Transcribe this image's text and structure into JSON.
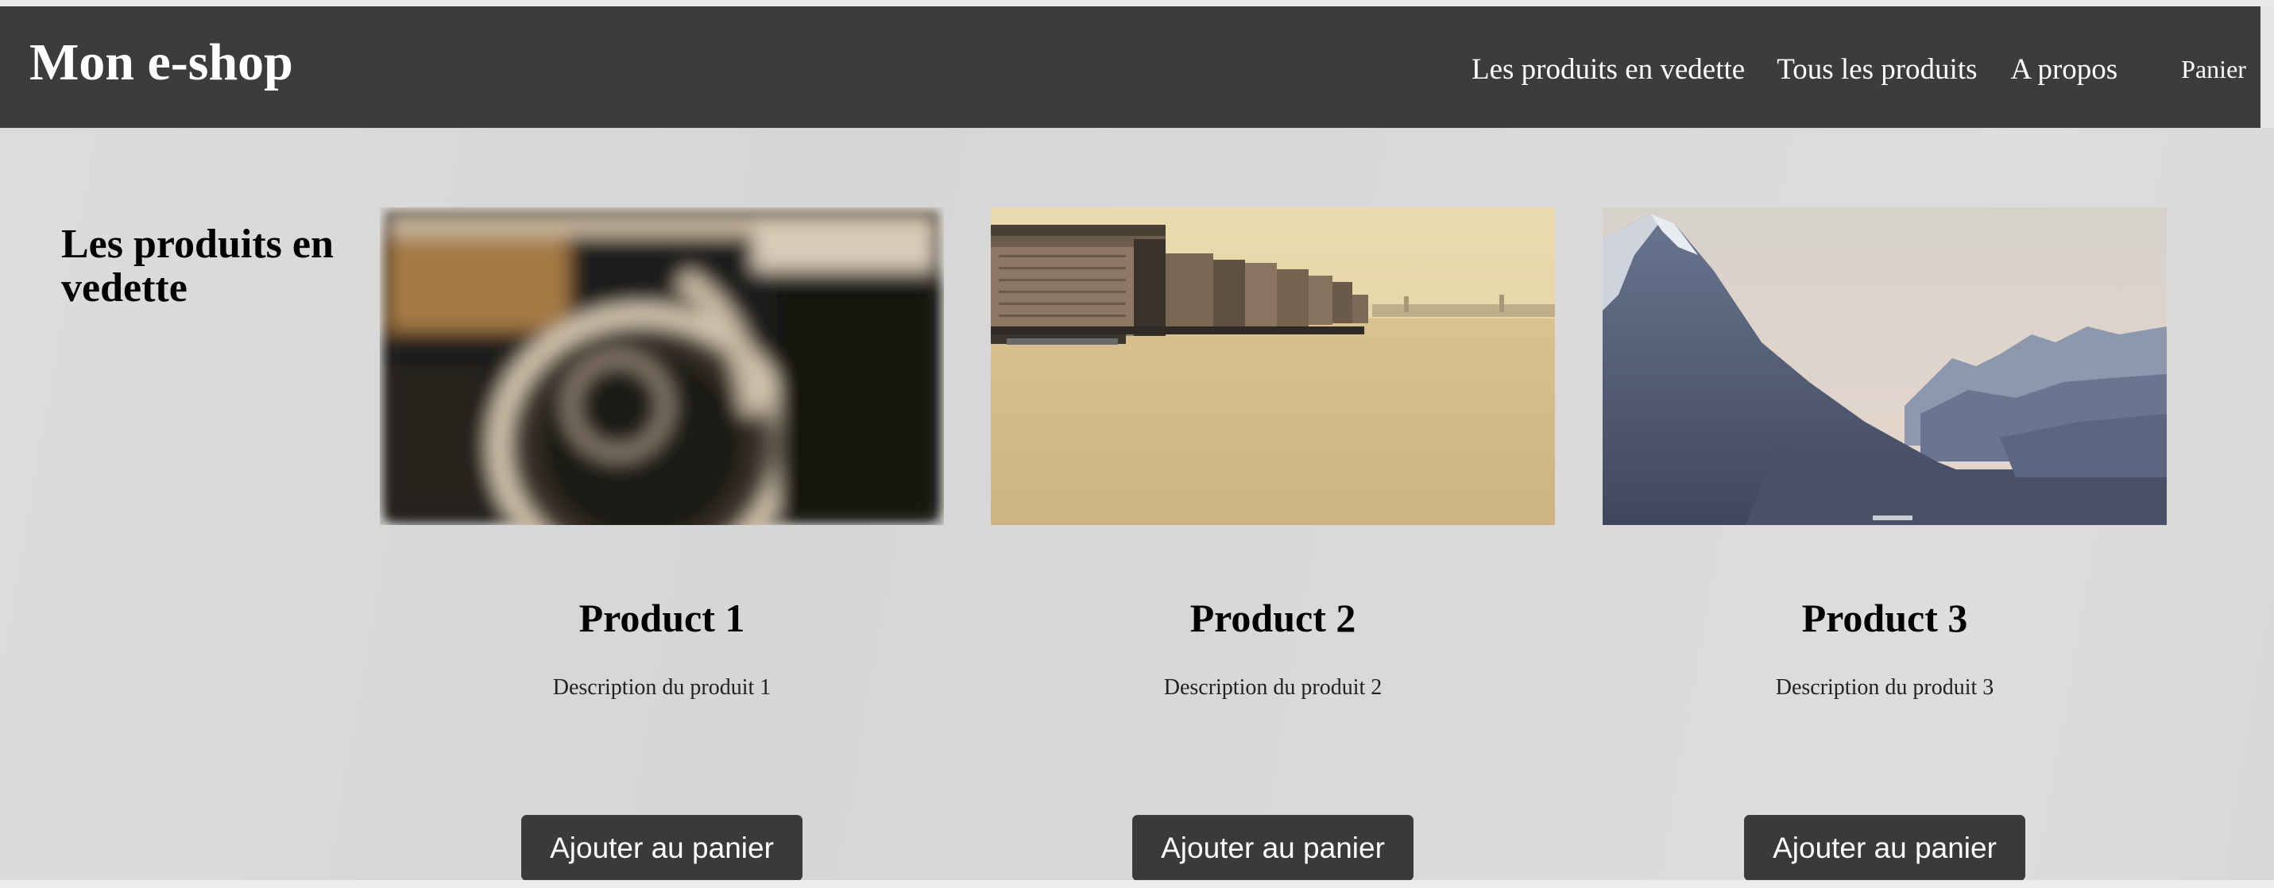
{
  "header": {
    "logo": "Mon e-shop",
    "nav": {
      "featured": "Les produits en vedette",
      "all_products": "Tous les produits",
      "about": "A propos",
      "cart": "Panier"
    }
  },
  "featured_section": {
    "title": "Les produits en vedette"
  },
  "products": [
    {
      "name": "Product 1",
      "description": "Description du produit 1",
      "button": "Ajouter au panier",
      "image": "blurred-camera-photo"
    },
    {
      "name": "Product 2",
      "description": "Description du produit 2",
      "button": "Ajouter au panier",
      "image": "riverside-city-photo"
    },
    {
      "name": "Product 3",
      "description": "Description du produit 3",
      "button": "Ajouter au panier",
      "image": "mountain-valley-photo"
    }
  ],
  "colors": {
    "header_bg": "#3c3c3c",
    "page_bg": "#d9d9d9",
    "button_bg": "#3a3a3a",
    "text_light": "#ffffff"
  }
}
